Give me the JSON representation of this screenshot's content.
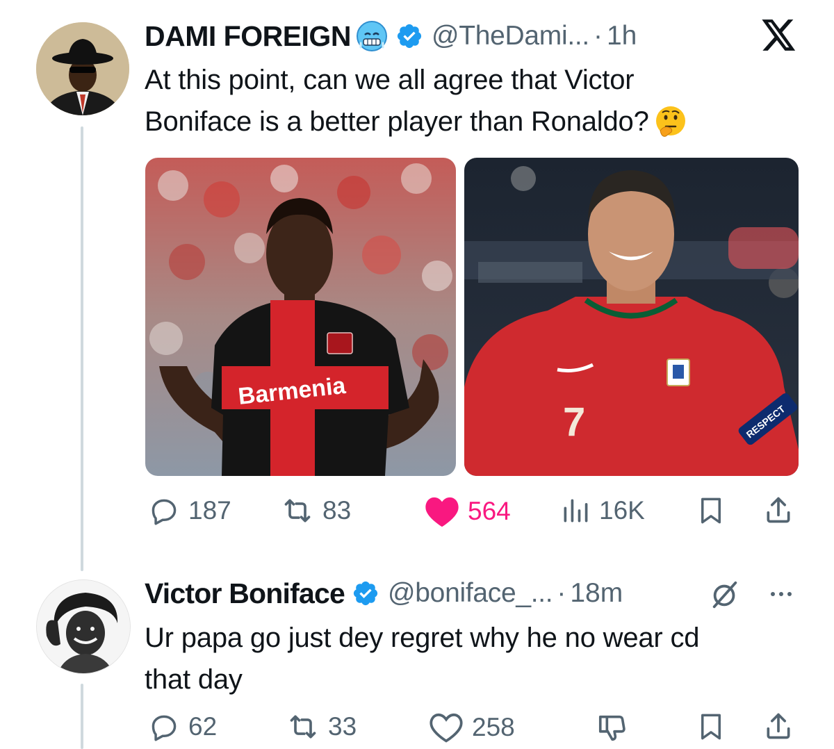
{
  "tweet1": {
    "display_name": "DAMI FOREIGN",
    "name_emoji": "cold-face-emoji",
    "verified_icon": "verified-badge-icon",
    "handle": "@TheDami...",
    "separator": "·",
    "time": "1h",
    "platform_logo": "x-logo-icon",
    "text_line1": "At this point, can we all agree that Victor",
    "text_line2": "Boniface is a better player than Ronaldo?",
    "text_emoji": "thinking-face-emoji",
    "images": [
      {
        "name": "boniface-photo",
        "jersey_text": "Barmenia"
      },
      {
        "name": "ronaldo-photo",
        "jersey_number": "7",
        "armband_text": "RESPECT"
      }
    ],
    "stats": {
      "replies": "187",
      "reposts": "83",
      "likes": "564",
      "views": "16K"
    },
    "liked": true,
    "colors": {
      "like": "#f91880",
      "verified": "#1d9bf0",
      "muted": "#536471"
    }
  },
  "tweet2": {
    "display_name": "Victor Boniface",
    "verified_icon": "verified-badge-icon",
    "handle": "@boniface_...",
    "separator": "·",
    "time": "18m",
    "text_line1": "Ur papa go just dey regret why he no wear cd",
    "text_line2": "that day",
    "stats": {
      "replies": "62",
      "reposts": "33",
      "likes": "258"
    }
  }
}
